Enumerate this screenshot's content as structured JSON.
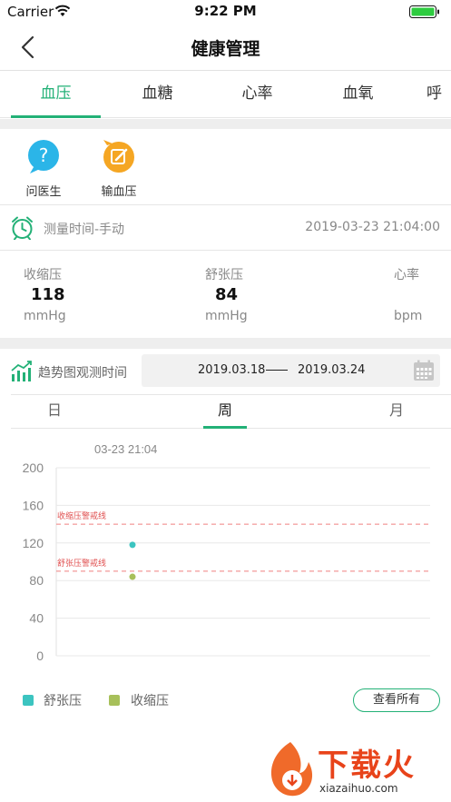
{
  "status_bar": {
    "carrier": "Carrier",
    "time": "9:22 PM"
  },
  "header": {
    "title": "健康管理"
  },
  "tabs": [
    {
      "label": "血压",
      "active": true
    },
    {
      "label": "血糖"
    },
    {
      "label": "心率"
    },
    {
      "label": "血氧"
    },
    {
      "label": "呼"
    }
  ],
  "quick_actions": [
    {
      "label": "问医生",
      "icon": "question-bubble-icon"
    },
    {
      "label": "输血压",
      "icon": "edit-bubble-icon"
    }
  ],
  "measure": {
    "label": "测量时间-手动",
    "value": "2019-03-23 21:04:00"
  },
  "readings": [
    {
      "label": "收缩压",
      "value": "118",
      "unit": "mmHg"
    },
    {
      "label": "舒张压",
      "value": "84",
      "unit": "mmHg"
    },
    {
      "label": "心率",
      "value": "",
      "unit": "bpm"
    }
  ],
  "trend": {
    "label": "趋势图观测时间",
    "start": "2019.03.18",
    "end": "2019.03.24"
  },
  "period_tabs": [
    {
      "label": "日"
    },
    {
      "label": "周",
      "active": true
    },
    {
      "label": "月"
    }
  ],
  "legend": {
    "diastolic": "舒张压",
    "systolic": "收缩压",
    "view_all": "查看所有"
  },
  "watermark": {
    "text": "下载火",
    "sub": "xiazaihuo.com"
  },
  "colors": {
    "accent": "#23b177",
    "diastolic": "#3cc4c0",
    "systolic": "#a7c05a",
    "warning": "#f08080"
  },
  "chart_data": {
    "type": "scatter",
    "point_label": "03-23 21:04",
    "ylim": [
      0,
      200
    ],
    "yticks": [
      "200",
      "160",
      "120",
      "80",
      "40",
      "0"
    ],
    "grid": true,
    "series": [
      {
        "name": "舒张压",
        "color": "#3cc4c0",
        "points": [
          {
            "x": "03-23 21:04",
            "y": 118
          }
        ]
      },
      {
        "name": "收缩压",
        "color": "#a7c05a",
        "points": [
          {
            "x": "03-23 21:04",
            "y": 84
          }
        ]
      }
    ],
    "reference_lines": [
      {
        "label": "收缩压警戒线",
        "y": 140
      },
      {
        "label": "舒张压警戒线",
        "y": 90
      }
    ]
  }
}
